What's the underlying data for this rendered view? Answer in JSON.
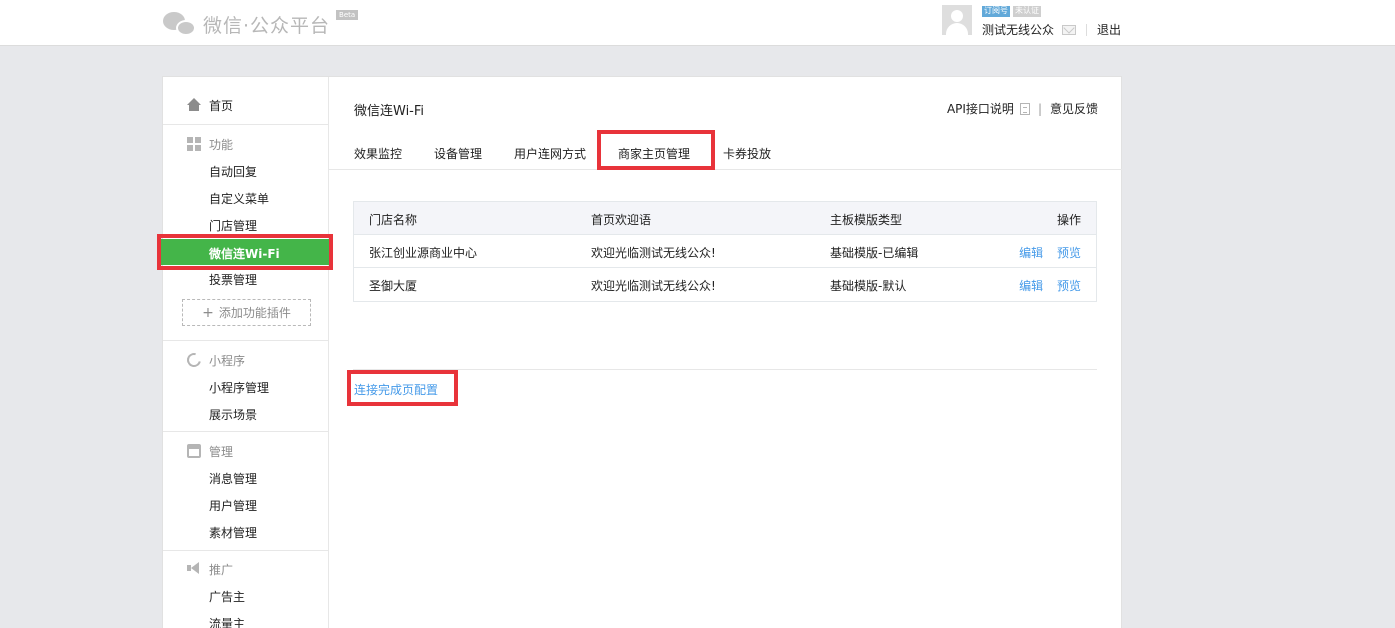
{
  "header": {
    "logo_text": "微信·公众平台",
    "beta": "Beta",
    "account_tags": [
      "订阅号",
      "未认证"
    ],
    "account_name": "测试无线公众",
    "logout": "退出"
  },
  "sidebar": {
    "home": "首页",
    "sections": [
      {
        "title": "功能",
        "icon": "grid-icon",
        "items": [
          "自动回复",
          "自定义菜单",
          "门店管理",
          "微信连Wi-Fi",
          "投票管理"
        ]
      },
      {
        "title": "小程序",
        "icon": "link-icon",
        "items": [
          "小程序管理",
          "展示场景"
        ]
      },
      {
        "title": "管理",
        "icon": "inbox-icon",
        "items": [
          "消息管理",
          "用户管理",
          "素材管理"
        ]
      },
      {
        "title": "推广",
        "icon": "megaphone-icon",
        "items": [
          "广告主",
          "流量主"
        ]
      }
    ],
    "active_item": "微信连Wi-Fi",
    "add_plugin": "添加功能插件"
  },
  "content": {
    "title": "微信连Wi-Fi",
    "api_doc": "API接口说明",
    "feedback": "意见反馈",
    "tabs": [
      "效果监控",
      "设备管理",
      "用户连网方式",
      "商家主页管理",
      "卡券投放"
    ],
    "active_tab": "商家主页管理",
    "table": {
      "headers": [
        "门店名称",
        "首页欢迎语",
        "主板模版类型",
        "操作"
      ],
      "rows": [
        {
          "store": "张江创业源商业中心",
          "welcome": "欢迎光临测试无线公众!",
          "template": "基础模版-已编辑",
          "actions": [
            "编辑",
            "预览"
          ]
        },
        {
          "store": "圣御大厦",
          "welcome": "欢迎光临测试无线公众!",
          "template": "基础模版-默认",
          "actions": [
            "编辑",
            "预览"
          ]
        }
      ]
    },
    "config_link": "连接完成页配置"
  },
  "colors": {
    "accent_green": "#44b549",
    "link_blue": "#459ae9",
    "highlight_red": "#e8333a"
  }
}
